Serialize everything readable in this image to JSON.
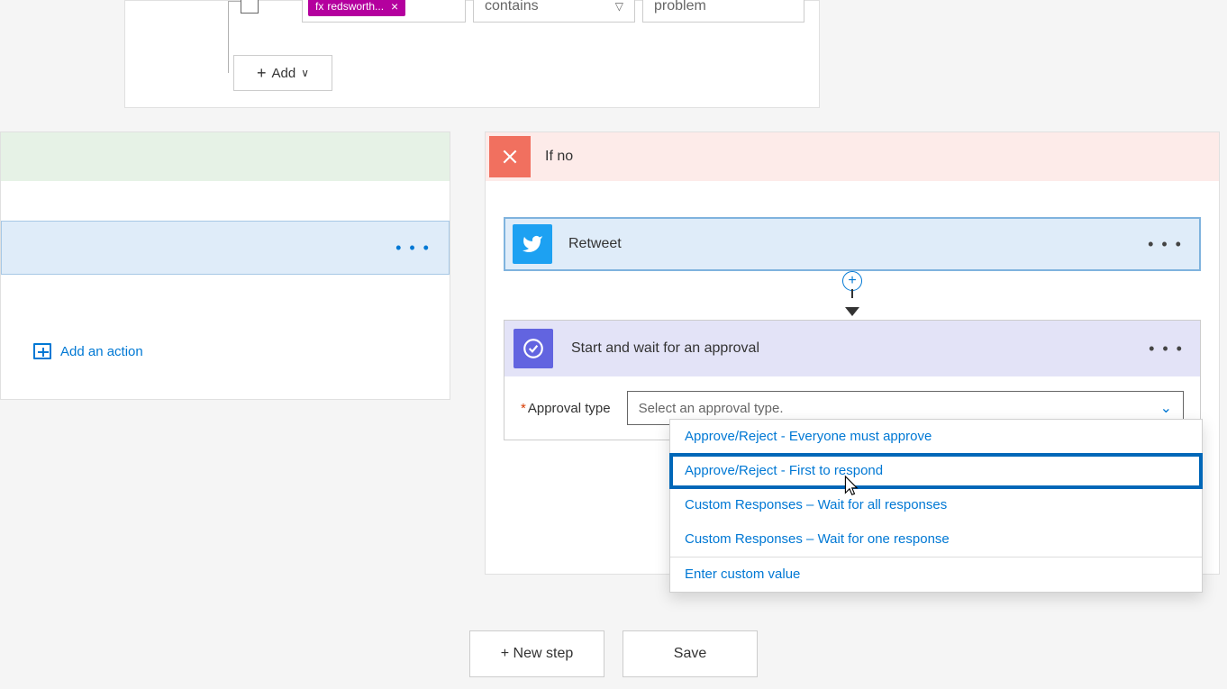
{
  "condition": {
    "token_label": "redsworth...",
    "operator": "contains",
    "value": "problem",
    "add_label": "Add"
  },
  "if_yes": {
    "add_action_label": "Add an action"
  },
  "if_no": {
    "title": "If no",
    "retweet_label": "Retweet",
    "approval": {
      "title": "Start and wait for an approval",
      "field_label": "Approval type",
      "placeholder": "Select an approval type.",
      "options": [
        "Approve/Reject - Everyone must approve",
        "Approve/Reject - First to respond",
        "Custom Responses – Wait for all responses",
        "Custom Responses – Wait for one response",
        "Enter custom value"
      ]
    }
  },
  "buttons": {
    "new_step": "+ New step",
    "save": "Save"
  }
}
